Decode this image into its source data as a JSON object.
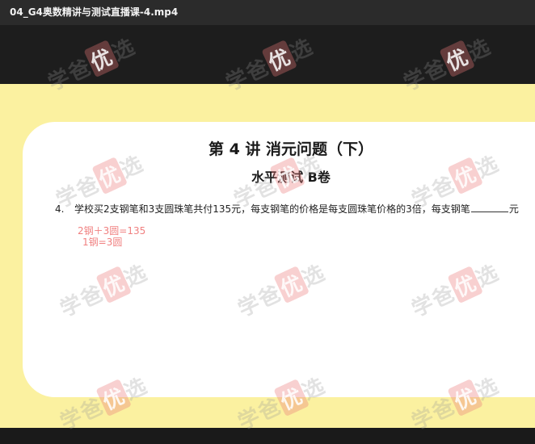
{
  "window": {
    "title": "04_G4奥数精讲与测试直播课-4.mp4"
  },
  "slide": {
    "lecture_title": "第 4 讲  消元问题（下）",
    "sub_title": "水平测试 B卷",
    "question": {
      "number": "4.",
      "text_before": "学校买2支钢笔和3支圆珠笔共付135元，每支钢笔的价格是每支圆珠笔价格的3倍，每支钢笔",
      "text_after": "元"
    },
    "notes": [
      "2钢＋3圆=135",
      "1钢=3圆"
    ]
  },
  "watermark": {
    "prefix": "学爸",
    "highlight": "优",
    "suffix": "选"
  },
  "colors": {
    "slide_background": "#fbf1a0",
    "note_color": "#f08080"
  }
}
